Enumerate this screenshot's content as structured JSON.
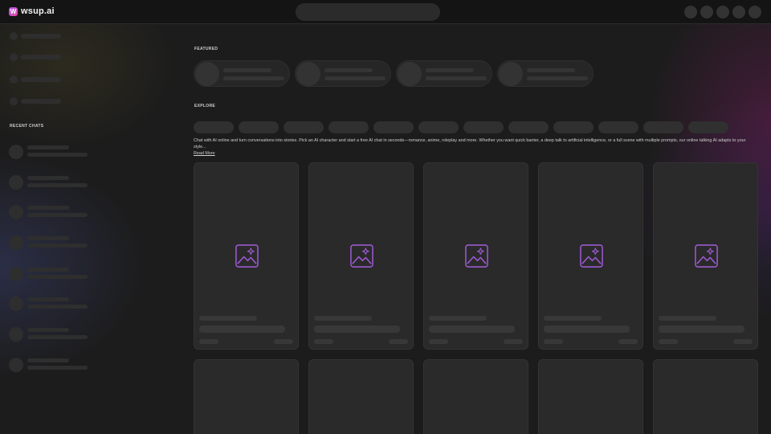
{
  "header": {
    "logo_text": "wsup.ai",
    "logo_mark": "W",
    "search_placeholder": "",
    "actions": [
      "action-1",
      "action-2",
      "action-3",
      "action-4",
      "action-5"
    ]
  },
  "sidebar": {
    "nav_items": [
      "nav-1",
      "nav-2",
      "nav-3",
      "nav-4"
    ],
    "recent_label": "RECENT CHATS",
    "recent_chats": [
      "chat-1",
      "chat-2",
      "chat-3",
      "chat-4",
      "chat-5",
      "chat-6",
      "chat-7",
      "chat-8"
    ]
  },
  "featured": {
    "label": "FEATURED",
    "cards": [
      "featured-1",
      "featured-2",
      "featured-3",
      "featured-4"
    ]
  },
  "explore": {
    "label": "EXPLORE",
    "chips": [
      "chip-1",
      "chip-2",
      "chip-3",
      "chip-4",
      "chip-5",
      "chip-6",
      "chip-7",
      "chip-8",
      "chip-9",
      "chip-10",
      "chip-11",
      "chip-12"
    ],
    "description": "Chat with AI online and turn conversations into stories. Pick an AI character and start a free AI chat in seconds—romance, anime, roleplay and more. Whether you want quick banter, a deep talk to artificial intelligence, or a full scene with multiple prompts, our online talking AI adapts to your style...",
    "read_more": "Read More",
    "cards_row1": [
      "card-1",
      "card-2",
      "card-3",
      "card-4",
      "card-5"
    ],
    "cards_row2": [
      "card-6",
      "card-7",
      "card-8",
      "card-9",
      "card-10"
    ]
  },
  "colors": {
    "background": "#1c1c1c",
    "header": "#141414",
    "skeleton": "#2e2e2e",
    "accent_icon": "#9b59d0"
  },
  "icons": {
    "logo": "wsup-logo-icon",
    "placeholder": "image-placeholder-icon"
  }
}
